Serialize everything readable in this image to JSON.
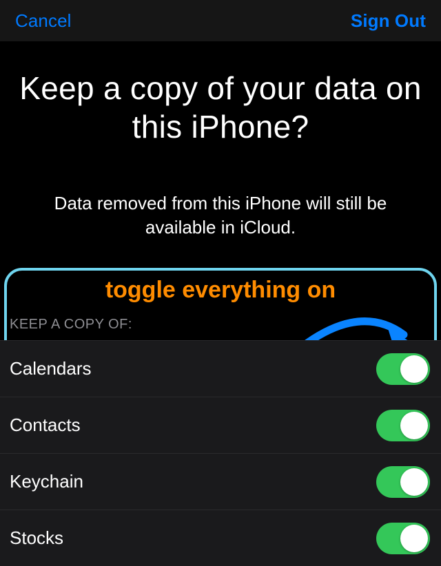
{
  "nav": {
    "cancel": "Cancel",
    "signout": "Sign Out"
  },
  "heading": "Keep a copy of your data on this iPhone?",
  "subheading": "Data removed from this iPhone will still be available in iCloud.",
  "callout": "toggle everything on",
  "section_header": "KEEP A COPY OF:",
  "items": [
    {
      "label": "Calendars",
      "on": true
    },
    {
      "label": "Contacts",
      "on": true
    },
    {
      "label": "Keychain",
      "on": true
    },
    {
      "label": "Stocks",
      "on": true
    }
  ],
  "colors": {
    "link": "#007aff",
    "toggle_on": "#34c759",
    "callout": "#ff8c00",
    "highlight_border": "#6fd5ef",
    "arrow": "#0a84ff"
  }
}
